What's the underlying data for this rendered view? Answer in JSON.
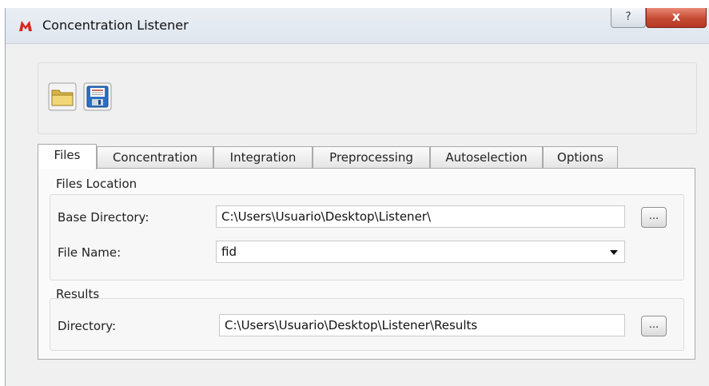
{
  "window": {
    "title": "Concentration Listener",
    "help_label": "?",
    "close_label": "x"
  },
  "toolbar": {
    "buttons": [
      {
        "name": "open",
        "icon": "folder-open-icon"
      },
      {
        "name": "save",
        "icon": "save-disk-icon"
      }
    ]
  },
  "tabs": [
    {
      "label": "Files",
      "active": true
    },
    {
      "label": "Concentration"
    },
    {
      "label": "Integration"
    },
    {
      "label": "Preprocessing"
    },
    {
      "label": "Autoselection"
    },
    {
      "label": "Options"
    }
  ],
  "files_location": {
    "title": "Files Location",
    "base_directory_label": "Base Directory:",
    "base_directory_value": "C:\\Users\\Usuario\\Desktop\\Listener\\",
    "file_name_label": "File Name:",
    "file_name_value": "fid",
    "browse_label": "..."
  },
  "results": {
    "title": "Results",
    "directory_label": "Directory:",
    "directory_value": "C:\\Users\\Usuario\\Desktop\\Listener\\Results",
    "browse_label": "..."
  },
  "colors": {
    "close": "#c54a33",
    "folder": "#e8c65a",
    "save": "#2b6fc4"
  }
}
